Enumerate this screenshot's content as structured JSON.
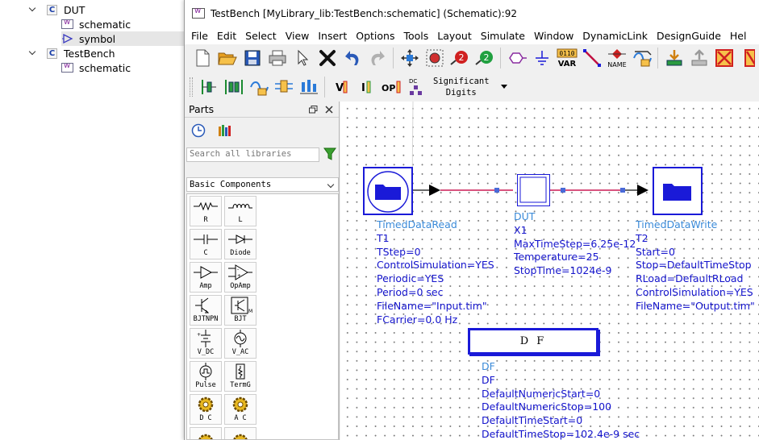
{
  "tree": {
    "items": [
      {
        "label": "DUT",
        "kind": "cell"
      },
      {
        "label": "schematic",
        "kind": "view-schematic"
      },
      {
        "label": "symbol",
        "kind": "view-symbol"
      },
      {
        "label": "TestBench",
        "kind": "cell"
      },
      {
        "label": "schematic",
        "kind": "view-schematic"
      }
    ],
    "cell_badge": "C"
  },
  "window": {
    "title": "TestBench [MyLibrary_lib:TestBench:schematic] (Schematic):92"
  },
  "menu": [
    "File",
    "Edit",
    "Select",
    "View",
    "Insert",
    "Options",
    "Tools",
    "Layout",
    "Simulate",
    "Window",
    "DynamicLink",
    "DesignGuide",
    "Hel"
  ],
  "toolbar": {
    "var_label": "VAR",
    "var_bits": "0110",
    "name_label": "NAME",
    "vi_label": "V",
    "ii_label": "I",
    "op_label": "OP",
    "dc_label": "DC",
    "significant_line1": "Significant",
    "significant_line2": "Digits"
  },
  "parts": {
    "title": "Parts",
    "search_placeholder": "Search all libraries",
    "library": "Basic Components",
    "components": [
      "R",
      "L",
      "C",
      "Diode",
      "Amp",
      "OpAmp",
      "BJTNPN",
      "BJT",
      "V_DC",
      "V_AC",
      "Pulse",
      "TermG",
      "D C",
      "A C",
      "",
      ""
    ]
  },
  "schematic": {
    "timed_read": {
      "type": "TimedDataRead",
      "instance": "T1",
      "params": [
        "TStep=0",
        "ControlSimulation=YES",
        "Periodic=YES",
        "Period=0 sec",
        "FileName=\"Input.tim\"",
        "FCarrier=0.0 Hz"
      ]
    },
    "dut": {
      "type": "DUT",
      "instance": "X1",
      "params": [
        "MaxTimeStep=6.25e-12",
        "Temperature=25",
        "StopTime=1024e-9"
      ]
    },
    "timed_write": {
      "type": "TimedDataWrite",
      "instance": "T2",
      "params": [
        "Start=0",
        "Stop=DefaultTimeStop",
        "RLoad=DefaultRLoad",
        "ControlSimulation=YES",
        "FileName=\"Output.tim\""
      ]
    },
    "df": {
      "block_label": "D F",
      "type": "DF",
      "instance": "DF",
      "params": [
        "DefaultNumericStart=0",
        "DefaultNumericStop=100",
        "DefaultTimeStart=0",
        "DefaultTimeStop=102.4e-9 sec"
      ]
    }
  },
  "colors": {
    "component_blue": "#1a1ad8",
    "annotation_header": "#3a8ad8",
    "annotation_param": "#1414cc",
    "wire": "#cc1a55"
  }
}
